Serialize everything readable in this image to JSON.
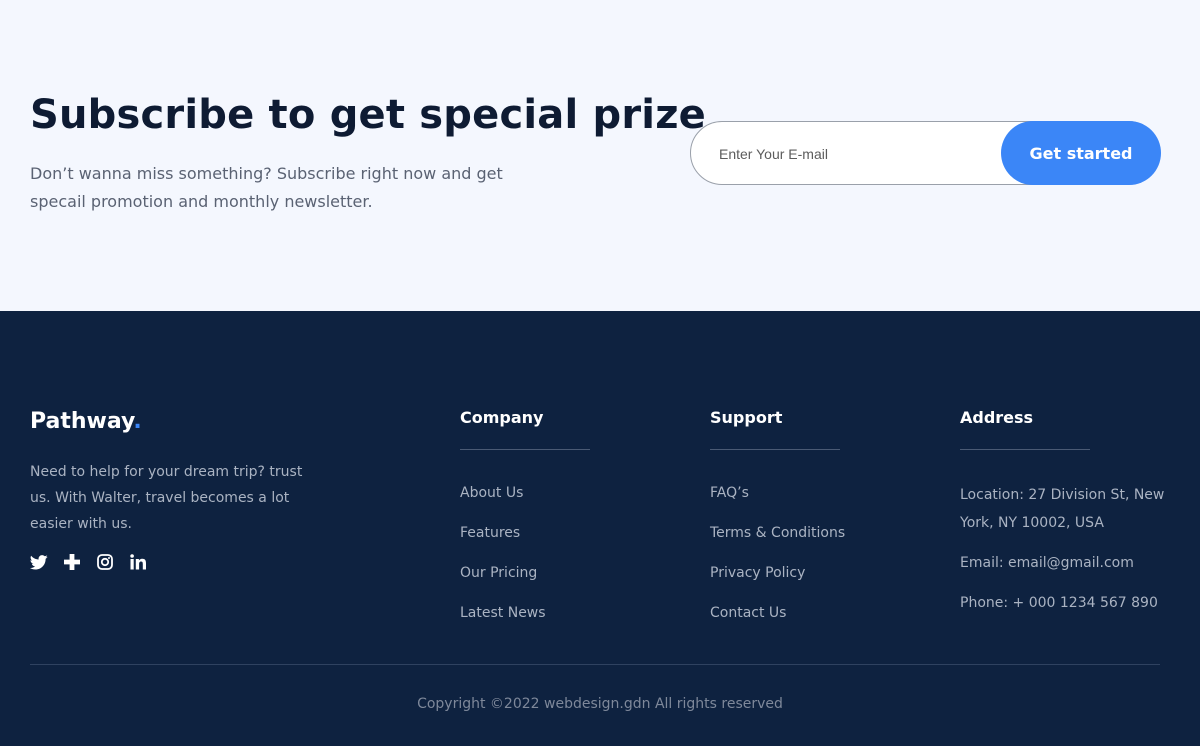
{
  "subscribe": {
    "title": "Subscribe to get special prize",
    "description": "Don’t wanna miss something? Subscribe right now and get specail promotion and monthly newsletter.",
    "email_placeholder": "Enter Your E-mail",
    "button_label": "Get started",
    "accent_color": "#3b86f7"
  },
  "footer": {
    "brand": {
      "name": "Pathway",
      "dot": "."
    },
    "about_text": "Need to help for your dream trip? trust us. With Walter, travel becomes a lot easier with us.",
    "socials": [
      "twitter-icon",
      "plus-icon",
      "instagram-icon",
      "linkedin-icon"
    ],
    "company": {
      "title": "Company",
      "links": [
        "About Us",
        "Features",
        "Our Pricing",
        "Latest News"
      ]
    },
    "support": {
      "title": "Support",
      "links": [
        "FAQ’s",
        "Terms & Conditions",
        "Privacy Policy",
        "Contact Us"
      ]
    },
    "address": {
      "title": "Address",
      "location": "Location: 27 Division St, New York, NY 10002, USA",
      "email": "Email: email@gmail.com",
      "phone": "Phone: + 000 1234 567 890"
    },
    "copyright": "Copyright ©2022 webdesign.gdn All rights reserved",
    "background_color": "#0e2240"
  }
}
